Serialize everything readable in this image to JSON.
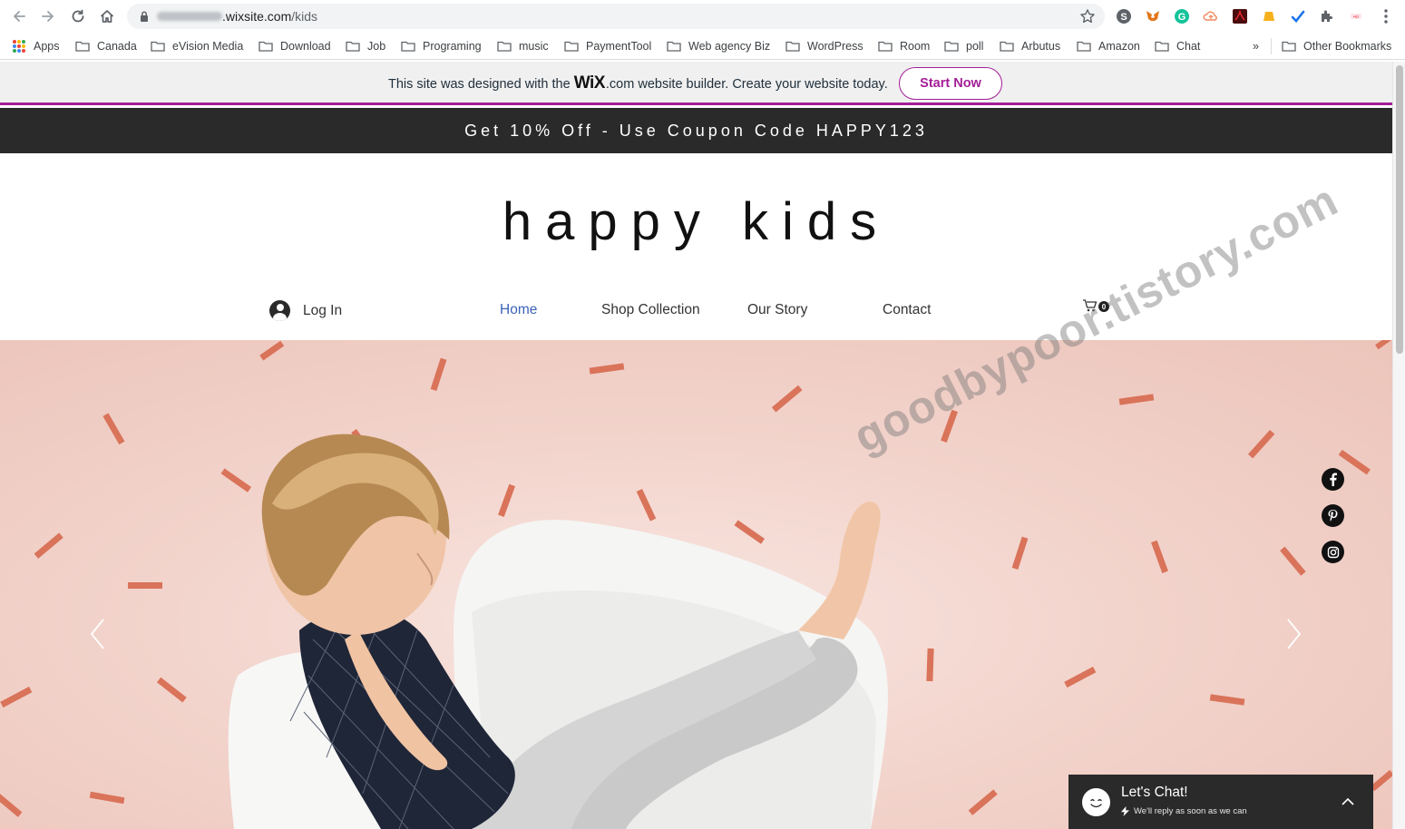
{
  "browser": {
    "url_domain": ".wixsite.com",
    "url_path": "/kids",
    "bookmarks": [
      {
        "label": "Apps"
      },
      {
        "label": "Canada"
      },
      {
        "label": "eVision Media"
      },
      {
        "label": "Download"
      },
      {
        "label": "Job"
      },
      {
        "label": "Programing"
      },
      {
        "label": "music"
      },
      {
        "label": "PaymentTool"
      },
      {
        "label": "Web agency Biz"
      },
      {
        "label": "WordPress"
      },
      {
        "label": "Room"
      },
      {
        "label": "poll"
      },
      {
        "label": "Arbutus"
      },
      {
        "label": "Amazon"
      },
      {
        "label": "Chat"
      }
    ],
    "overflow_chevron": "»",
    "other_bookmarks": "Other Bookmarks"
  },
  "wix_banner": {
    "text_before": "This site was designed with the",
    "logo": "WiX",
    "text_after": ".com website builder. Create your website today.",
    "button": "Start Now",
    "accent_color": "#a31e97"
  },
  "coupon": {
    "text": "Get 10% Off - Use Coupon Code HAPPY123"
  },
  "site": {
    "logo": "happy kids",
    "login": "Log In",
    "nav": [
      {
        "label": "Home",
        "active": true
      },
      {
        "label": "Shop Collection",
        "active": false
      },
      {
        "label": "Our Story",
        "active": false
      },
      {
        "label": "Contact",
        "active": false
      }
    ],
    "cart_count": "0",
    "active_color": "#3b63b8"
  },
  "hero": {
    "social": [
      "facebook-icon",
      "pinterest-icon",
      "instagram-icon"
    ],
    "background_color": "#f2d4cc",
    "confetti_color": "#d9735a"
  },
  "watermark": "goodbypoor.tistory.com",
  "chat": {
    "title": "Let's Chat!",
    "subtitle": "We'll reply as soon as we can"
  }
}
